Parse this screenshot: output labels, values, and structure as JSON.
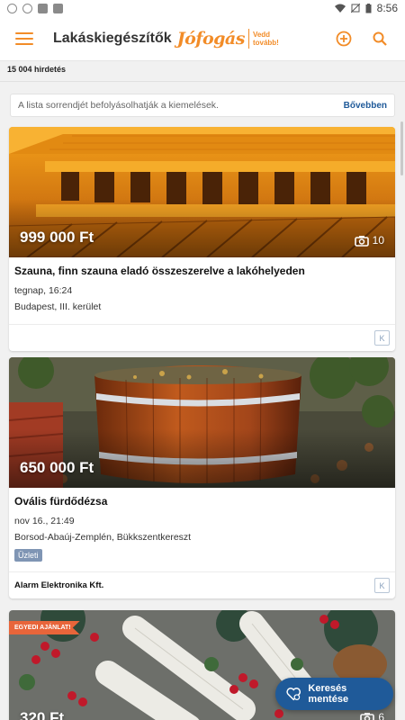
{
  "status_bar": {
    "time": "8:56",
    "icons": [
      "gps-icon",
      "wifi-icon",
      "muted-icon",
      "battery-icon"
    ]
  },
  "app_bar": {
    "title": "Lakáskiegészítők",
    "logo_text": "Jófogás",
    "logo_tagline": "Vedd tovább!",
    "icons": [
      "menu-icon",
      "add-icon",
      "search-icon"
    ],
    "accent_color": "#f28c28"
  },
  "results": {
    "count_text": "15 004 hirdetés"
  },
  "info_box": {
    "text": "A lista sorrendjét befolyásolhatják a kiemelések.",
    "more_label": "Bővebben"
  },
  "listings": [
    {
      "price": "999 000 Ft",
      "photo_count": "10",
      "title": "Szauna, finn szauna eladó összeszerelve a lakóhelyeden",
      "date": "tegnap, 16:24",
      "location": "Budapest, III. kerület",
      "k_label": "K"
    },
    {
      "price": "650 000 Ft",
      "photo_count": "",
      "title": "Ovális fürdődézsa",
      "date": "nov 16., 21:49",
      "location": "Borsod-Abaúj-Zemplén, Bükkszentkereszt",
      "badge": "Üzleti",
      "seller": "Alarm Elektronika Kft.",
      "k_label": "K"
    },
    {
      "ribbon": "EGYEDI AJÁNLAT!",
      "price": "320 Ft",
      "photo_count": "6"
    }
  ],
  "fab": {
    "label": "Keresés mentése",
    "color": "#1f5a99"
  }
}
